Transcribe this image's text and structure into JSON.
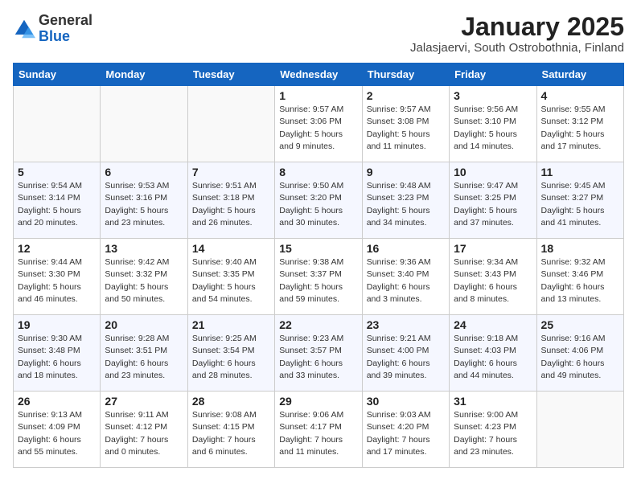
{
  "header": {
    "logo": {
      "general": "General",
      "blue": "Blue"
    },
    "title": "January 2025",
    "subtitle": "Jalasjaervi, South Ostrobothnia, Finland"
  },
  "columns": [
    "Sunday",
    "Monday",
    "Tuesday",
    "Wednesday",
    "Thursday",
    "Friday",
    "Saturday"
  ],
  "weeks": [
    [
      {
        "day": "",
        "info": ""
      },
      {
        "day": "",
        "info": ""
      },
      {
        "day": "",
        "info": ""
      },
      {
        "day": "1",
        "info": "Sunrise: 9:57 AM\nSunset: 3:06 PM\nDaylight: 5 hours\nand 9 minutes."
      },
      {
        "day": "2",
        "info": "Sunrise: 9:57 AM\nSunset: 3:08 PM\nDaylight: 5 hours\nand 11 minutes."
      },
      {
        "day": "3",
        "info": "Sunrise: 9:56 AM\nSunset: 3:10 PM\nDaylight: 5 hours\nand 14 minutes."
      },
      {
        "day": "4",
        "info": "Sunrise: 9:55 AM\nSunset: 3:12 PM\nDaylight: 5 hours\nand 17 minutes."
      }
    ],
    [
      {
        "day": "5",
        "info": "Sunrise: 9:54 AM\nSunset: 3:14 PM\nDaylight: 5 hours\nand 20 minutes."
      },
      {
        "day": "6",
        "info": "Sunrise: 9:53 AM\nSunset: 3:16 PM\nDaylight: 5 hours\nand 23 minutes."
      },
      {
        "day": "7",
        "info": "Sunrise: 9:51 AM\nSunset: 3:18 PM\nDaylight: 5 hours\nand 26 minutes."
      },
      {
        "day": "8",
        "info": "Sunrise: 9:50 AM\nSunset: 3:20 PM\nDaylight: 5 hours\nand 30 minutes."
      },
      {
        "day": "9",
        "info": "Sunrise: 9:48 AM\nSunset: 3:23 PM\nDaylight: 5 hours\nand 34 minutes."
      },
      {
        "day": "10",
        "info": "Sunrise: 9:47 AM\nSunset: 3:25 PM\nDaylight: 5 hours\nand 37 minutes."
      },
      {
        "day": "11",
        "info": "Sunrise: 9:45 AM\nSunset: 3:27 PM\nDaylight: 5 hours\nand 41 minutes."
      }
    ],
    [
      {
        "day": "12",
        "info": "Sunrise: 9:44 AM\nSunset: 3:30 PM\nDaylight: 5 hours\nand 46 minutes."
      },
      {
        "day": "13",
        "info": "Sunrise: 9:42 AM\nSunset: 3:32 PM\nDaylight: 5 hours\nand 50 minutes."
      },
      {
        "day": "14",
        "info": "Sunrise: 9:40 AM\nSunset: 3:35 PM\nDaylight: 5 hours\nand 54 minutes."
      },
      {
        "day": "15",
        "info": "Sunrise: 9:38 AM\nSunset: 3:37 PM\nDaylight: 5 hours\nand 59 minutes."
      },
      {
        "day": "16",
        "info": "Sunrise: 9:36 AM\nSunset: 3:40 PM\nDaylight: 6 hours\nand 3 minutes."
      },
      {
        "day": "17",
        "info": "Sunrise: 9:34 AM\nSunset: 3:43 PM\nDaylight: 6 hours\nand 8 minutes."
      },
      {
        "day": "18",
        "info": "Sunrise: 9:32 AM\nSunset: 3:46 PM\nDaylight: 6 hours\nand 13 minutes."
      }
    ],
    [
      {
        "day": "19",
        "info": "Sunrise: 9:30 AM\nSunset: 3:48 PM\nDaylight: 6 hours\nand 18 minutes."
      },
      {
        "day": "20",
        "info": "Sunrise: 9:28 AM\nSunset: 3:51 PM\nDaylight: 6 hours\nand 23 minutes."
      },
      {
        "day": "21",
        "info": "Sunrise: 9:25 AM\nSunset: 3:54 PM\nDaylight: 6 hours\nand 28 minutes."
      },
      {
        "day": "22",
        "info": "Sunrise: 9:23 AM\nSunset: 3:57 PM\nDaylight: 6 hours\nand 33 minutes."
      },
      {
        "day": "23",
        "info": "Sunrise: 9:21 AM\nSunset: 4:00 PM\nDaylight: 6 hours\nand 39 minutes."
      },
      {
        "day": "24",
        "info": "Sunrise: 9:18 AM\nSunset: 4:03 PM\nDaylight: 6 hours\nand 44 minutes."
      },
      {
        "day": "25",
        "info": "Sunrise: 9:16 AM\nSunset: 4:06 PM\nDaylight: 6 hours\nand 49 minutes."
      }
    ],
    [
      {
        "day": "26",
        "info": "Sunrise: 9:13 AM\nSunset: 4:09 PM\nDaylight: 6 hours\nand 55 minutes."
      },
      {
        "day": "27",
        "info": "Sunrise: 9:11 AM\nSunset: 4:12 PM\nDaylight: 7 hours\nand 0 minutes."
      },
      {
        "day": "28",
        "info": "Sunrise: 9:08 AM\nSunset: 4:15 PM\nDaylight: 7 hours\nand 6 minutes."
      },
      {
        "day": "29",
        "info": "Sunrise: 9:06 AM\nSunset: 4:17 PM\nDaylight: 7 hours\nand 11 minutes."
      },
      {
        "day": "30",
        "info": "Sunrise: 9:03 AM\nSunset: 4:20 PM\nDaylight: 7 hours\nand 17 minutes."
      },
      {
        "day": "31",
        "info": "Sunrise: 9:00 AM\nSunset: 4:23 PM\nDaylight: 7 hours\nand 23 minutes."
      },
      {
        "day": "",
        "info": ""
      }
    ]
  ]
}
